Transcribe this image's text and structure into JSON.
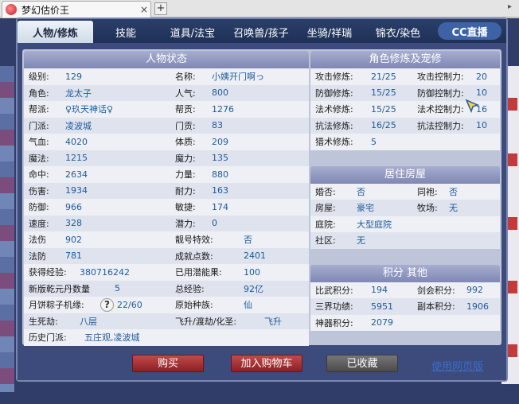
{
  "window": {
    "tab_title": "梦幻估价王",
    "close": "×",
    "new_tab": "+"
  },
  "nav": {
    "tabs": [
      "人物/修炼",
      "技能",
      "道具/法宝",
      "召唤兽/孩子",
      "坐骑/祥瑞",
      "锦衣/染色"
    ],
    "logo": "CC直播"
  },
  "status": {
    "title": "人物状态",
    "rows": [
      [
        [
          "级别:",
          "129"
        ],
        [
          "名称:",
          "小姨开门啊っ"
        ]
      ],
      [
        [
          "角色:",
          "龙太子"
        ],
        [
          "人气:",
          "800"
        ]
      ],
      [
        [
          "帮派:",
          "♀玖天神话♀"
        ],
        [
          "帮贡:",
          "1276"
        ]
      ],
      [
        [
          "门派:",
          "凌波城"
        ],
        [
          "门贡:",
          "83"
        ]
      ],
      [
        [
          "气血:",
          "4020"
        ],
        [
          "体质:",
          "209"
        ]
      ],
      [
        [
          "魔法:",
          "1215"
        ],
        [
          "魔力:",
          "135"
        ]
      ],
      [
        [
          "命中:",
          "2634"
        ],
        [
          "力量:",
          "880"
        ]
      ],
      [
        [
          "伤害:",
          "1934"
        ],
        [
          "耐力:",
          "163"
        ]
      ],
      [
        [
          "防御:",
          "966"
        ],
        [
          "敏捷:",
          "174"
        ]
      ],
      [
        [
          "速度:",
          "328"
        ],
        [
          "潜力:",
          "0"
        ]
      ],
      [
        [
          "法伤",
          "902"
        ],
        [
          "靓号特效:",
          "否"
        ]
      ],
      [
        [
          "法防",
          "781"
        ],
        [
          "成就点数:",
          "2401"
        ]
      ],
      [
        [
          "获得经验:",
          "380716242"
        ],
        [
          "已用潜能果:",
          "100"
        ]
      ],
      [
        [
          "新版乾元丹数量",
          "5"
        ],
        [
          "总经验:",
          "92亿"
        ]
      ],
      [
        [
          "月饼粽子机缘:",
          "22/60"
        ],
        [
          "原始种族:",
          "仙"
        ]
      ],
      [
        [
          "生死劫:",
          "八层"
        ],
        [
          "飞升/渡劫/化圣:",
          "飞升"
        ]
      ],
      [
        [
          "历史门派:",
          "五庄观,凌波城"
        ],
        [
          "",
          ""
        ]
      ]
    ]
  },
  "cultivation": {
    "title": "角色修炼及宠修",
    "rows": [
      [
        [
          "攻击修炼:",
          "21/25"
        ],
        [
          "攻击控制力:",
          "20"
        ]
      ],
      [
        [
          "防御修炼:",
          "15/25"
        ],
        [
          "防御控制力:",
          "10"
        ]
      ],
      [
        [
          "法术修炼:",
          "15/25"
        ],
        [
          "法术控制力:",
          "16"
        ]
      ],
      [
        [
          "抗法修炼:",
          "16/25"
        ],
        [
          "抗法控制力:",
          "10"
        ]
      ],
      [
        [
          "猎术修炼:",
          "5"
        ],
        [
          "",
          ""
        ]
      ]
    ]
  },
  "housing": {
    "title": "居住房屋",
    "rows": [
      [
        [
          "婚否:",
          "否"
        ],
        [
          "同袍:",
          "否"
        ]
      ],
      [
        [
          "房屋:",
          "豪宅"
        ],
        [
          "牧场:",
          "无"
        ]
      ],
      [
        [
          "庭院:",
          "大型庭院"
        ],
        [
          "",
          ""
        ]
      ],
      [
        [
          "社区:",
          "无"
        ],
        [
          "",
          ""
        ]
      ]
    ]
  },
  "points": {
    "title": "积分 其他",
    "rows": [
      [
        [
          "比武积分:",
          "194"
        ],
        [
          "剑会积分:",
          "992"
        ]
      ],
      [
        [
          "三界功绩:",
          "5951"
        ],
        [
          "副本积分:",
          "1906"
        ]
      ],
      [
        [
          "神器积分:",
          "2079"
        ],
        [
          "",
          ""
        ]
      ]
    ]
  },
  "footer": {
    "buy": "购买",
    "add_cart": "加入购物车",
    "collected": "已收藏",
    "web_version": "使用网页版"
  },
  "help_icon": "?",
  "colors": {
    "accent": "#1d5a9a",
    "header": "#7f87b4",
    "red_button": "#8a1f24"
  }
}
